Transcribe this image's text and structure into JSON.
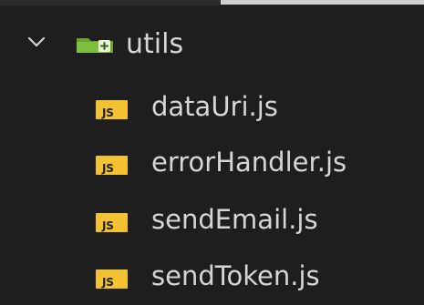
{
  "explorer": {
    "folder": {
      "name": "utils",
      "expanded": true,
      "icon": "folder-open-icon",
      "accent_color": "#7fbf3f"
    },
    "files": [
      {
        "name": "dataUri.js",
        "icon_text": "JS"
      },
      {
        "name": "errorHandler.js",
        "icon_text": "JS"
      },
      {
        "name": "sendEmail.js",
        "icon_text": "JS"
      },
      {
        "name": "sendToken.js",
        "icon_text": "JS"
      }
    ],
    "colors": {
      "background": "#1e1e1e",
      "text": "#d6d6d6",
      "js_icon": "#f2c232"
    }
  }
}
